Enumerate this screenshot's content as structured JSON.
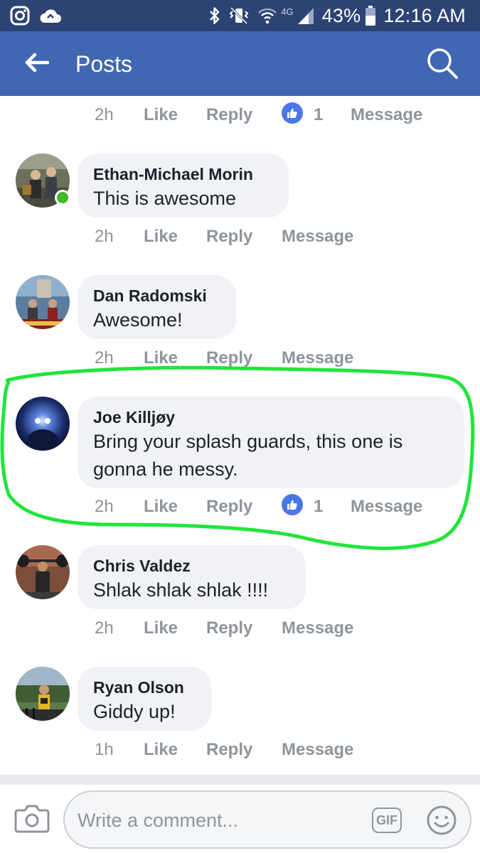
{
  "status_bar": {
    "left_icons": [
      "instagram-icon",
      "cloud-sync-icon"
    ],
    "right_icons": [
      "bluetooth-icon",
      "vibrate-icon",
      "wifi-icon",
      "signal-icon",
      "battery-icon"
    ],
    "network": "4G",
    "battery": "43%",
    "time": "12:16 AM"
  },
  "app_bar": {
    "title": "Posts",
    "background": "#4267b2"
  },
  "top_partial_meta": {
    "time": "2h",
    "like_label": "Like",
    "reply_label": "Reply",
    "likes": "1",
    "message_label": "Message"
  },
  "comments": [
    {
      "author": "Ethan-Michael Morin",
      "lines": [
        "This is awesome"
      ],
      "time": "2h",
      "like_label": "Like",
      "reply_label": "Reply",
      "message_label": "Message",
      "online": true
    },
    {
      "author": "Dan Radomski",
      "lines": [
        "Awesome!"
      ],
      "time": "2h",
      "like_label": "Like",
      "reply_label": "Reply",
      "message_label": "Message"
    },
    {
      "author": "Joe Killjøy",
      "lines": [
        "Bring your splash guards, this one is",
        "gonna he messy."
      ],
      "time": "2h",
      "like_label": "Like",
      "reply_label": "Reply",
      "likes": "1",
      "message_label": "Message",
      "highlighted": true
    },
    {
      "author": "Chris Valdez",
      "lines": [
        "Shlak shlak shlak !!!!"
      ],
      "time": "2h",
      "like_label": "Like",
      "reply_label": "Reply",
      "message_label": "Message"
    },
    {
      "author": "Ryan Olson",
      "lines": [
        "Giddy up!"
      ],
      "time": "1h",
      "like_label": "Like",
      "reply_label": "Reply",
      "message_label": "Message"
    }
  ],
  "composer": {
    "placeholder": "Write a comment...",
    "gif_label": "GIF"
  },
  "colors": {
    "status_bar": "#2d4373",
    "app_bar": "#4267b2",
    "bubble": "#f1f2f6",
    "meta_text": "#90949c",
    "like_blue": "#4a76e8",
    "online_green": "#42b72a",
    "highlight_green": "#22e43c"
  }
}
